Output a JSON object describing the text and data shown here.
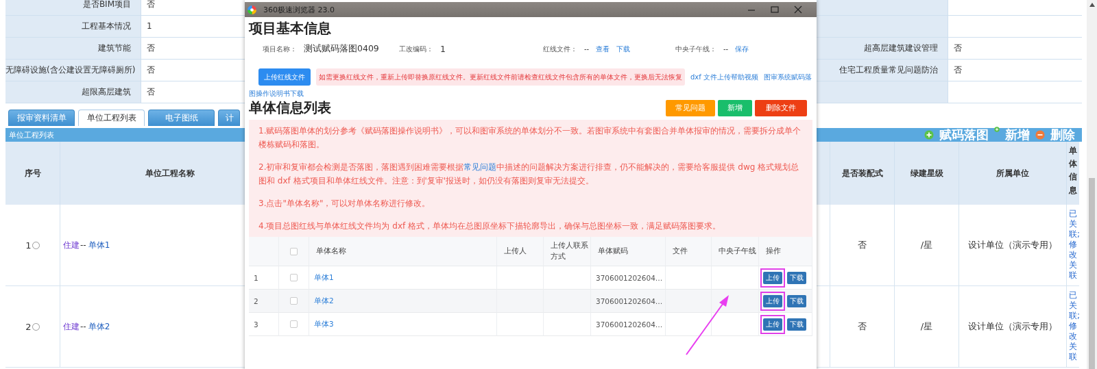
{
  "info_rows": [
    {
      "label": "是否BIM项目",
      "value": "否"
    },
    {
      "label": "工程基本情况",
      "value": "1"
    },
    {
      "label": "建筑节能",
      "value": "否",
      "right_label": "超高层建筑建设管理",
      "right_value": "否"
    },
    {
      "label": "无障碍设施(含公建设置无障碍厕所)",
      "value": "否",
      "right_label": "住宅工程质量常见问题防治",
      "right_value": "否"
    },
    {
      "label": "超限高层建筑",
      "value": "否"
    }
  ],
  "tabs": [
    {
      "label": "报审资料清单",
      "selected": false
    },
    {
      "label": "单位工程列表",
      "selected": true
    },
    {
      "label": "电子图纸",
      "selected": false
    },
    {
      "label": "计",
      "selected": false
    }
  ],
  "section": {
    "title": "单位工程列表",
    "actions": [
      {
        "kind": "add",
        "label": "赋码落图"
      },
      {
        "kind": "dot",
        "label": "新增"
      },
      {
        "kind": "remove",
        "label": "删除"
      }
    ]
  },
  "table": {
    "columns": [
      "序号",
      "单位工程名称",
      "是否装配式",
      "绿建星级",
      "所属单位",
      "单体信息"
    ],
    "rows": [
      {
        "index": "1",
        "selected": false,
        "category": "住建",
        "separator": "--",
        "name": "单体1",
        "prefab": "否",
        "green_level": "/星",
        "unit": "设计单位（演示专用）",
        "info": "已关联;修改关联"
      },
      {
        "index": "2",
        "selected": false,
        "category": "住建",
        "separator": "--",
        "name": "单体2",
        "prefab": "否",
        "green_level": "/星",
        "unit": "设计单位（演示专用）",
        "info": "已关联;修改关联"
      }
    ]
  },
  "popup": {
    "title": "360极速浏览器 23.0",
    "heading": "项目基本信息",
    "fields": [
      {
        "label": "项目名称：",
        "value": "测试赋码落图0409"
      },
      {
        "label": "工改编码：",
        "value": "1"
      },
      {
        "label": "红线文件：",
        "value": "--",
        "links": [
          "查看",
          "下载"
        ]
      },
      {
        "label": "中央子午线：",
        "value": "--",
        "links": [
          "保存"
        ]
      }
    ],
    "upload_button": "上传红线文件",
    "notice": "如需更换红线文件，重新上传即替换原红线文件。更新红线文件前请检查红线文件包含所有的单体文件，更换后无法恢复",
    "links": [
      "dxf 文件上传帮助视频",
      "图审系统赋码落"
    ],
    "wrapped_link": "图操作说明书下载",
    "list_heading": "单体信息列表",
    "buttons": [
      {
        "kind": "warning",
        "label": "常见问题"
      },
      {
        "kind": "success",
        "label": "新增"
      },
      {
        "kind": "danger",
        "label": "删除文件"
      }
    ],
    "tips": [
      {
        "text": "1.赋码落图单体的划分参考《赋码落图操作说明书》，可以和图审系统的单体划分不一致。若图审系统中有套图合并单体报审的情况，需要拆分成单个楼栋赋码和落图。"
      },
      {
        "text": "2.初审和复审都会检测是否落图，落图遇到困难需要根据",
        "link": "常见问题",
        "after": "中描述的问题解决方案进行排查，仍不能解决的，需要给客服提供 dwg 格式规划总图和 dxf 格式项目和单体红线文件。注意：到'复审'报送时，如仍没有落图则复审无法提交。"
      },
      {
        "text": "3.点击\"单体名称\"，可以对单体名称进行修改。"
      },
      {
        "text": "4.项目总图红线与单体红线文件均为 dxf 格式，单体均在总图原坐标下描轮廓导出，确保与总图坐标一致，满足赋码落图要求。"
      }
    ],
    "table": {
      "header_checked": false,
      "columns": [
        "单体名称",
        "上传人",
        "上传人联系方式",
        "单体赋码",
        "文件",
        "中央子午线",
        "操作"
      ],
      "rows": [
        {
          "index": "1",
          "checked": false,
          "name": "单体1",
          "code": "3706001202604…",
          "actions": [
            "上传",
            "下载"
          ],
          "highlighted": true
        },
        {
          "index": "2",
          "checked": false,
          "name": "单体2",
          "code": "3706001202604…",
          "actions": [
            "上传",
            "下载"
          ],
          "highlighted": true
        },
        {
          "index": "3",
          "checked": false,
          "name": "单体3",
          "code": "3706001202604…",
          "actions": [
            "上传",
            "下载"
          ],
          "highlighted": true
        }
      ]
    }
  }
}
